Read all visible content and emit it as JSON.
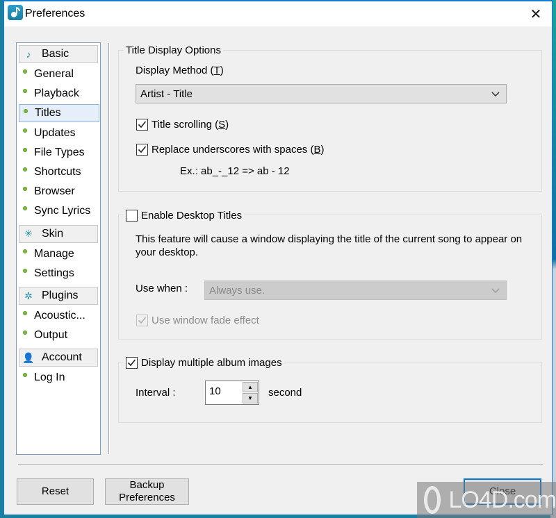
{
  "window": {
    "title": "Preferences",
    "close_glyph": "✕"
  },
  "sidebar": {
    "categories": [
      {
        "label": "Basic",
        "icon": "music-note-icon",
        "glyph": "♪",
        "items": [
          {
            "label": "General",
            "selected": false
          },
          {
            "label": "Playback",
            "selected": false
          },
          {
            "label": "Titles",
            "selected": true
          },
          {
            "label": "Updates",
            "selected": false
          },
          {
            "label": "File Types",
            "selected": false
          },
          {
            "label": "Shortcuts",
            "selected": false
          },
          {
            "label": "Browser",
            "selected": false
          },
          {
            "label": "Sync Lyrics",
            "selected": false
          }
        ]
      },
      {
        "label": "Skin",
        "icon": "magic-wand-icon",
        "glyph": "✳",
        "items": [
          {
            "label": "Manage",
            "selected": false
          },
          {
            "label": "Settings",
            "selected": false
          }
        ]
      },
      {
        "label": "Plugins",
        "icon": "gear-icon",
        "glyph": "✲",
        "items": [
          {
            "label": "Acoustic...",
            "selected": false
          },
          {
            "label": "Output",
            "selected": false
          }
        ]
      },
      {
        "label": "Account",
        "icon": "user-icon",
        "glyph": "👤",
        "items": [
          {
            "label": "Log In",
            "selected": false
          }
        ]
      }
    ]
  },
  "title_display": {
    "group_label": "Title Display Options",
    "method_label": "Display Method (",
    "method_accel": "T",
    "method_close": ")",
    "method_value": "Artist - Title",
    "scrolling_label": "Title scrolling (",
    "scrolling_accel": "S",
    "scrolling_close": ")",
    "scrolling_checked": true,
    "underscores_label": "Replace underscores with spaces (",
    "underscores_accel": "B",
    "underscores_close": ")",
    "underscores_checked": true,
    "example": "Ex.: ab_-_12 => ab - 12"
  },
  "desktop_titles": {
    "label": "Enable Desktop Titles",
    "checked": false,
    "description": "This feature will cause a window displaying the title of the current song to appear on your desktop.",
    "use_when_label": "Use when :",
    "use_when_value": "Always use.",
    "fade_label": "Use window fade effect",
    "fade_checked": true,
    "fade_disabled": true
  },
  "album_images": {
    "label": "Display multiple album images",
    "checked": true,
    "interval_label": "Interval :",
    "interval_value": "10",
    "interval_unit": "second"
  },
  "buttons": {
    "reset": "Reset",
    "backup_line1": "Backup",
    "backup_line2": "Preferences",
    "close": "Close"
  },
  "watermark": {
    "text": "LO4D.com"
  }
}
